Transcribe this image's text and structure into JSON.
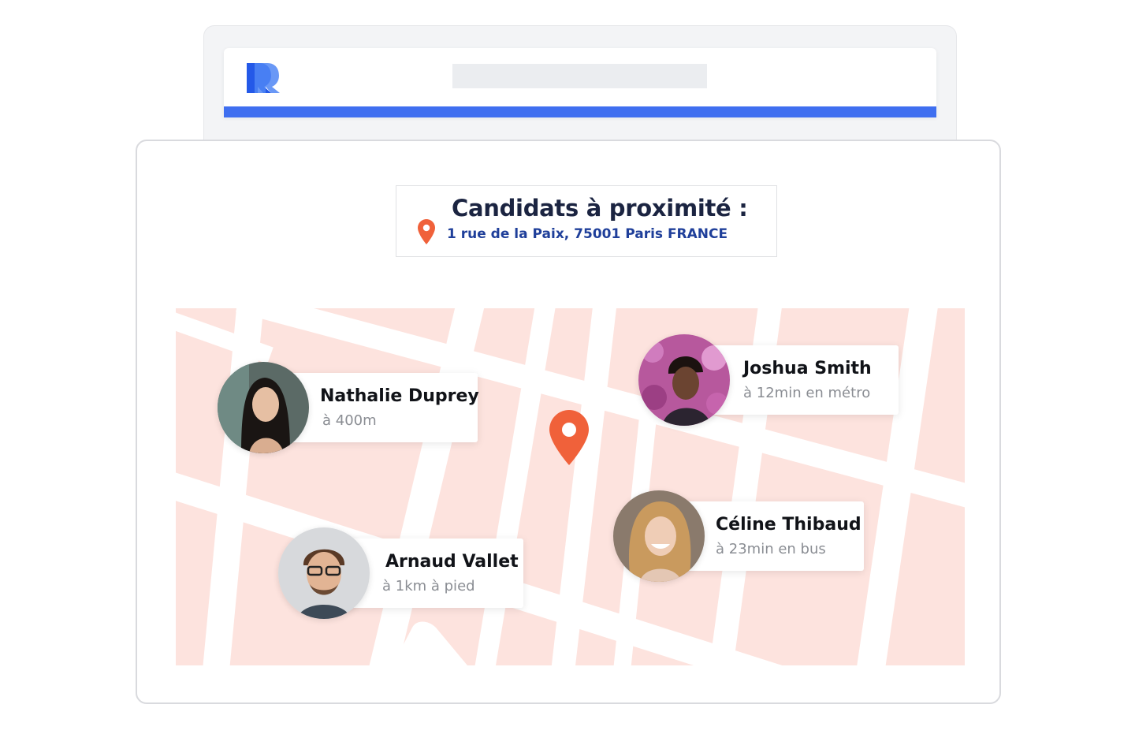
{
  "header": {
    "title": "Candidats à proximité :",
    "address": "1 rue de la Paix, 75001 Paris FRANCE"
  },
  "colors": {
    "accent": "#3f6ff0",
    "pin": "#f0613a",
    "map_block": "#fde3de",
    "title": "#1b2441",
    "address": "#1f3f9a"
  },
  "candidates": [
    {
      "name": "Nathalie Duprey",
      "distance": "à 400m"
    },
    {
      "name": "Joshua Smith",
      "distance": "à 12min en métro"
    },
    {
      "name": "Arnaud Vallet",
      "distance": "à 1km à pied"
    },
    {
      "name": "Céline Thibaud",
      "distance": "à 23min en bus"
    }
  ]
}
